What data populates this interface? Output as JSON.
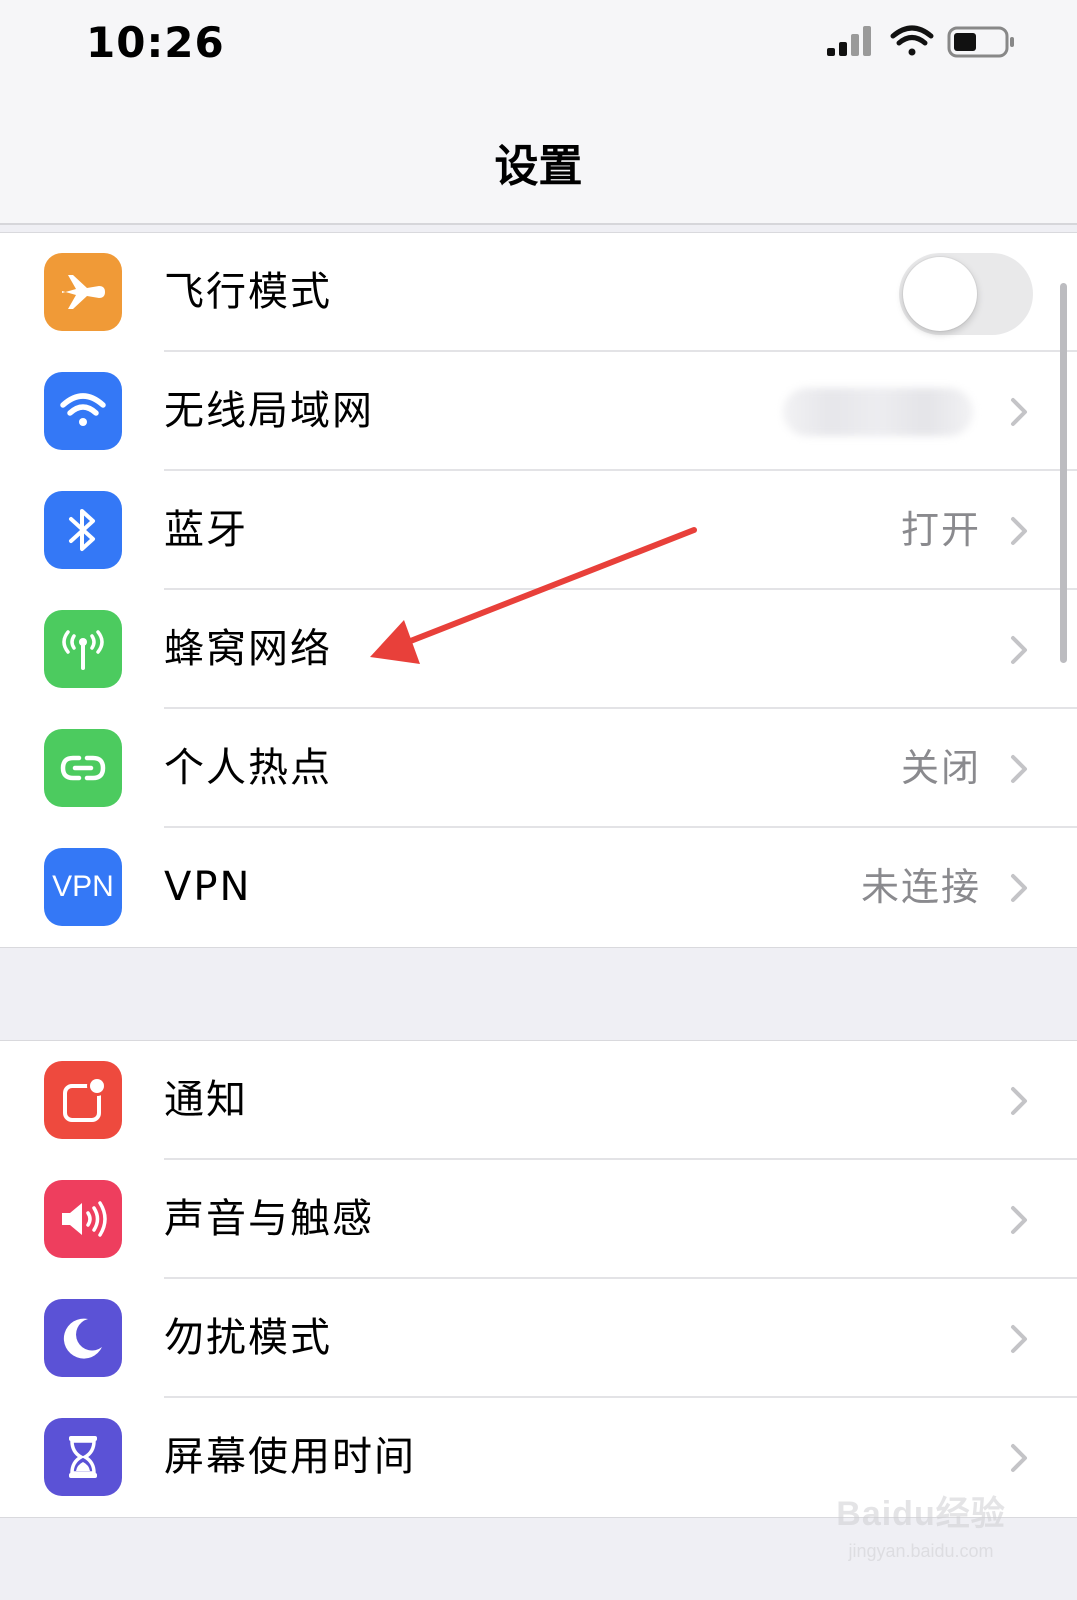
{
  "status_bar": {
    "time": "10:26",
    "icons": [
      "cellular-signal-icon",
      "wifi-icon",
      "battery-icon"
    ]
  },
  "nav": {
    "title": "设置"
  },
  "groups": [
    {
      "rows": [
        {
          "label": "飞行模式",
          "icon": "airplane-icon",
          "icon_color": "#F09A37",
          "control": "toggle",
          "toggle_on": false
        },
        {
          "label": "无线局域网",
          "icon": "wifi-icon",
          "icon_color": "#3478F6",
          "value_obscured": true
        },
        {
          "label": "蓝牙",
          "icon": "bluetooth-icon",
          "icon_color": "#3478F6",
          "value": "打开"
        },
        {
          "label": "蜂窝网络",
          "icon": "cellular-antenna-icon",
          "icon_color": "#4CCB5F",
          "value": ""
        },
        {
          "label": "个人热点",
          "icon": "hotspot-icon",
          "icon_color": "#4CCB5F",
          "value": "关闭"
        },
        {
          "label": "VPN",
          "icon": "vpn-icon",
          "icon_color": "#3478F6",
          "value": "未连接",
          "icon_text": "VPN"
        }
      ]
    },
    {
      "rows": [
        {
          "label": "通知",
          "icon": "notifications-icon",
          "icon_color": "#EE4A3E"
        },
        {
          "label": "声音与触感",
          "icon": "sound-icon",
          "icon_color": "#EE3E5E"
        },
        {
          "label": "勿扰模式",
          "icon": "moon-icon",
          "icon_color": "#5B52D6"
        },
        {
          "label": "屏幕使用时间",
          "icon": "hourglass-icon",
          "icon_color": "#5B52D6"
        }
      ]
    }
  ],
  "annotation": {
    "type": "arrow",
    "color": "#E8403A",
    "target": "蜂窝网络"
  },
  "watermark": {
    "logo": "Baidu经验",
    "url": "jingyan.baidu.com"
  }
}
